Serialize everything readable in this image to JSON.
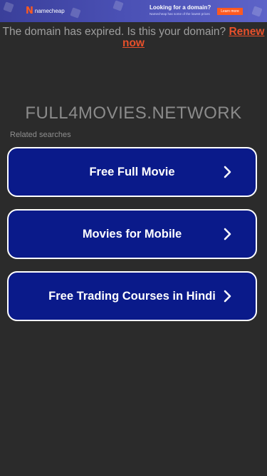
{
  "banner": {
    "logo_text": "namecheap",
    "title": "Looking for a domain?",
    "subtitle": "Namecheap has some of the lowest prices",
    "cta_label": "Learn more"
  },
  "notice": {
    "text": "The domain has expired. Is this your domain?",
    "renew_label": "Renew now"
  },
  "domain_title": "FULL4MOVIES.NETWORK",
  "related_label": "Related searches",
  "links": [
    {
      "label": "Free Full Movie",
      "icon": "chevron-right-icon"
    },
    {
      "label": "Movies for Mobile",
      "icon": "chevron-right-icon"
    },
    {
      "label": "Free Trading Courses in Hindi",
      "icon": "chevron-right-icon"
    }
  ],
  "colors": {
    "background": "#2b2b2b",
    "button_fill": "#0a1a8a",
    "accent_orange": "#e8502b"
  }
}
